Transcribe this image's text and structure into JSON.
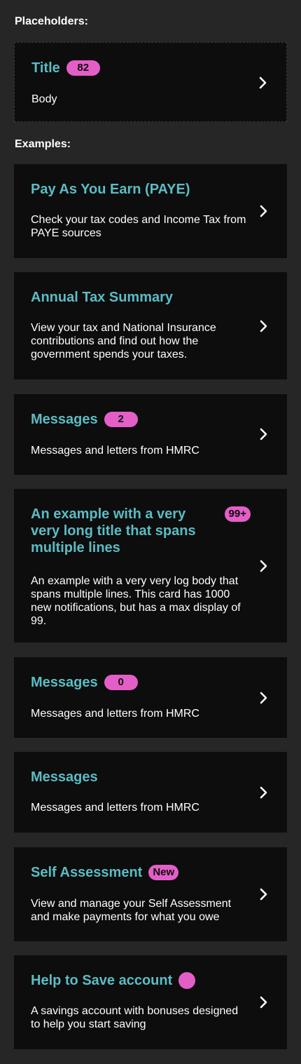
{
  "placeholders_label": "Placeholders:",
  "examples_label": "Examples:",
  "placeholder_card": {
    "title": "Title",
    "badge": "82",
    "body": "Body"
  },
  "cards": [
    {
      "title": "Pay As You Earn (PAYE)",
      "body": "Check your tax codes and Income Tax from PAYE sources"
    },
    {
      "title": "Annual Tax Summary",
      "body": "View your tax and National Insurance contributions and find out how the government spends your taxes."
    },
    {
      "title": "Messages",
      "badge": "2",
      "body": "Messages and letters from HMRC"
    },
    {
      "title": "An example with a very very long title that spans multiple lines",
      "badge": "99+",
      "body": "An example with a very very log body that spans multiple lines. This card has 1000 new notifications, but has a max display of 99."
    },
    {
      "title": "Messages",
      "badge": "0",
      "body": "Messages and letters from HMRC"
    },
    {
      "title": "Messages",
      "body": "Messages and letters from HMRC"
    },
    {
      "title": "Self Assessment",
      "badge": "New",
      "body": "View and manage your Self Assessment and make payments for what you owe"
    },
    {
      "title": "Help to Save account",
      "body": "A savings account with bonuses designed to help you start saving"
    }
  ],
  "colors": {
    "background": "#262626",
    "card": "#0c0d0c",
    "title": "#5bbcc5",
    "badge": "#e45ec8",
    "text": "#ffffff"
  },
  "icons": {
    "chevron": "chevron-right-icon",
    "dot": "notification-dot-icon"
  }
}
